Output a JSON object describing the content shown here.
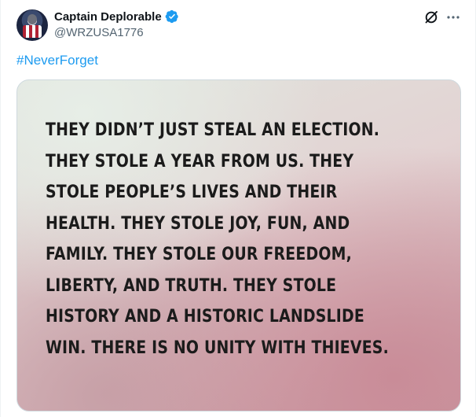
{
  "post": {
    "author": {
      "display_name": "Captain Deplorable",
      "handle": "@WRZUSA1776",
      "verified": true
    },
    "hashtag": "#NeverForget",
    "image_text_lines": [
      "THEY DIDN’T JUST STEAL AN ELECTION.",
      "THEY STOLE A YEAR FROM US. THEY",
      "STOLE PEOPLE’S LIVES AND THEIR",
      "HEALTH. THEY STOLE JOY, FUN, AND",
      "FAMILY. THEY STOLE OUR FREEDOM,",
      "LIBERTY, AND TRUTH. THEY STOLE",
      "HISTORY AND A HISTORIC LANDSLIDE",
      "WIN. THERE IS NO UNITY WITH THIEVES."
    ]
  },
  "icons": {
    "verified": "verified-badge-icon",
    "grok": "grok-icon",
    "more": "more-icon"
  },
  "colors": {
    "link": "#1d9bf0",
    "verified": "#1d9bf0",
    "secondary_text": "#536471",
    "primary_text": "#0f1419"
  }
}
